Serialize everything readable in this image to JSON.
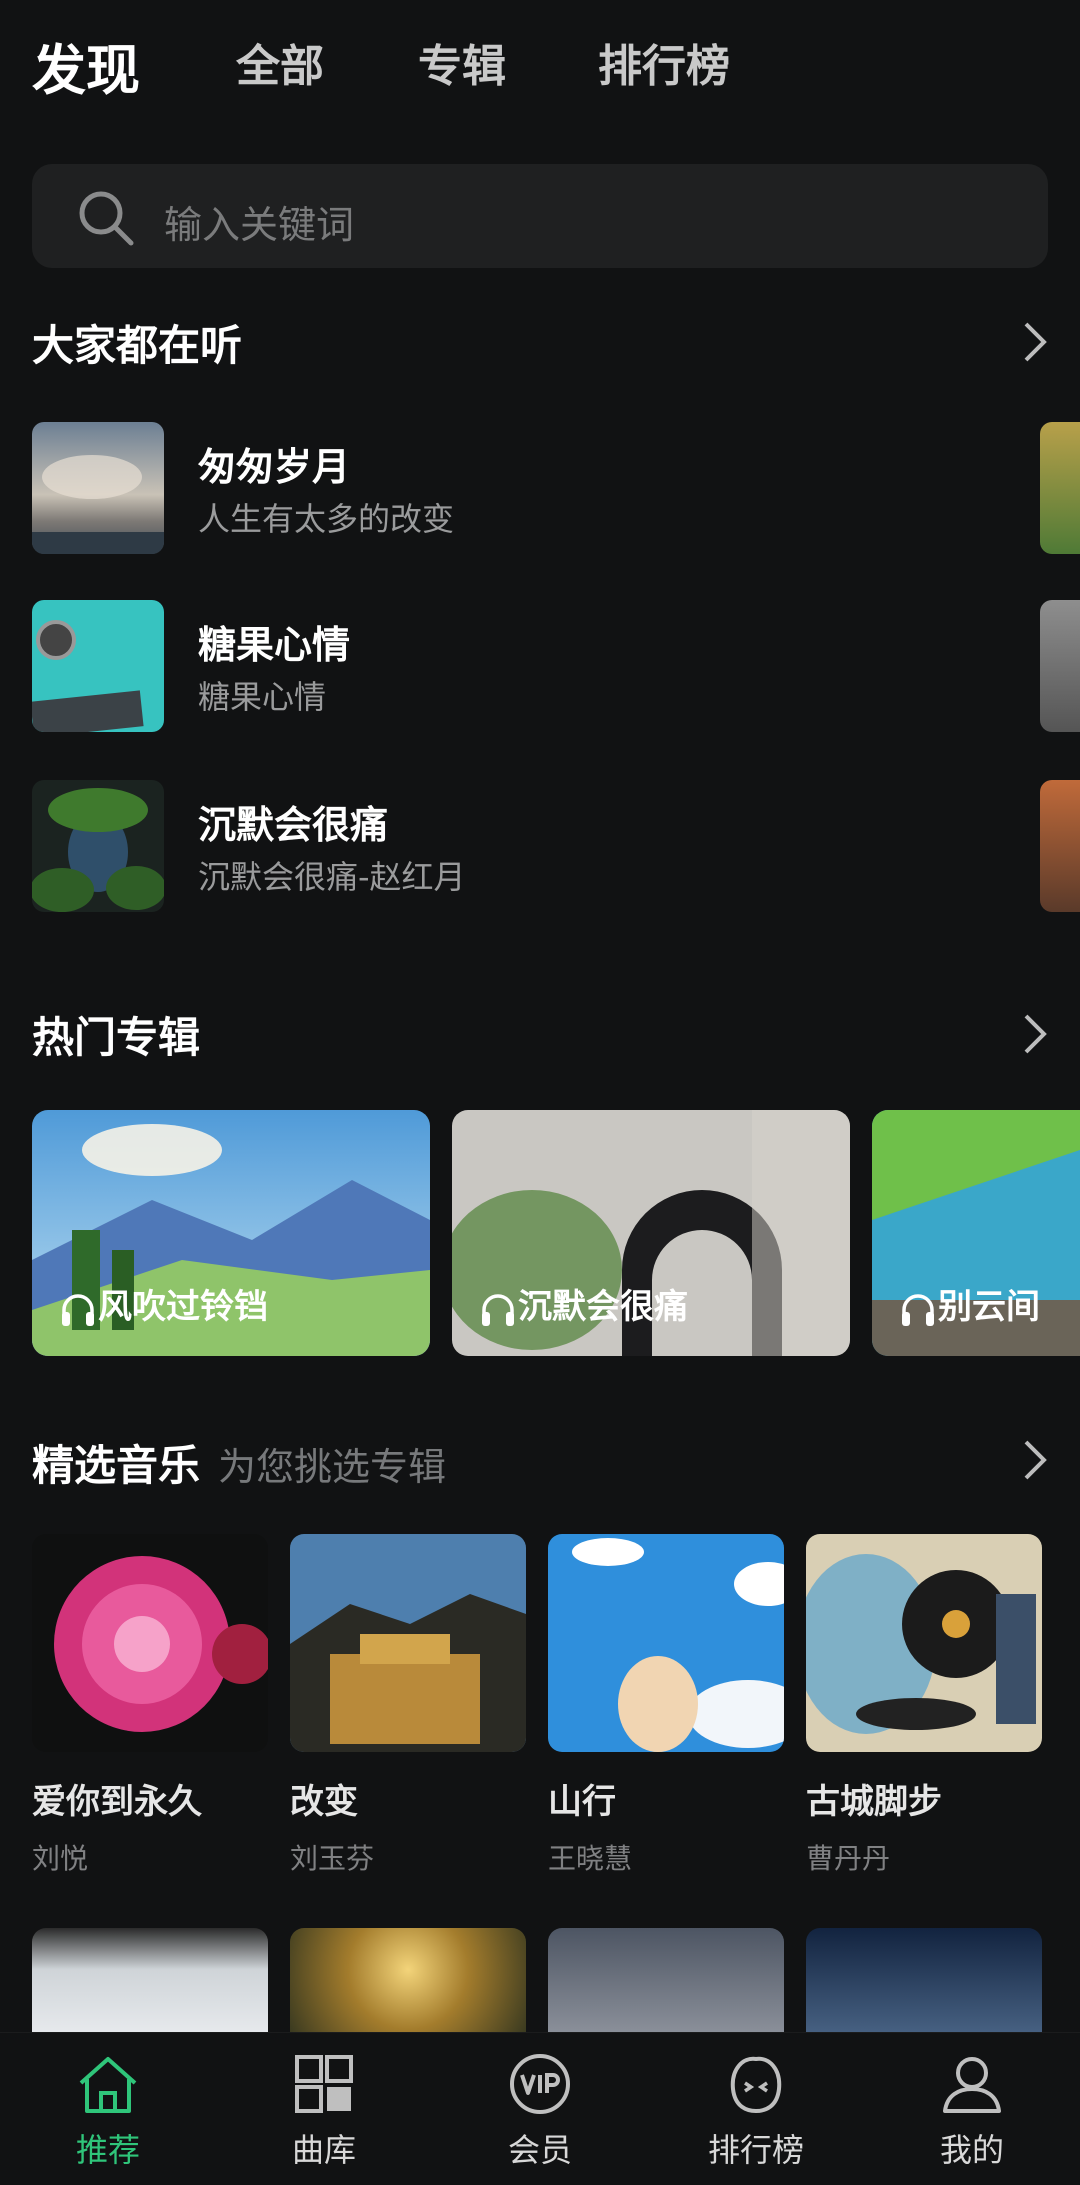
{
  "top_tabs": [
    "发现",
    "全部",
    "专辑",
    "排行榜"
  ],
  "search": {
    "placeholder": "输入关键词"
  },
  "popular": {
    "title": "大家都在听",
    "songs": [
      {
        "title": "匆匆岁月",
        "subtitle": "人生有太多的改变"
      },
      {
        "title": "糖果心情",
        "subtitle": "糖果心情"
      },
      {
        "title": "沉默会很痛",
        "subtitle": "沉默会很痛-赵红月"
      }
    ]
  },
  "hot_albums": {
    "title": "热门专辑",
    "albums": [
      "风吹过铃铛",
      "沉默会很痛",
      "别云间"
    ]
  },
  "featured": {
    "title": "精选音乐",
    "subtitle": "为您挑选专辑",
    "items": [
      {
        "name": "爱你到永久",
        "artist": "刘悦"
      },
      {
        "name": "改变",
        "artist": "刘玉芬"
      },
      {
        "name": "山行",
        "artist": "王晓慧"
      },
      {
        "name": "古城脚步",
        "artist": "曹丹丹"
      }
    ]
  },
  "bottom_nav": [
    "推荐",
    "曲库",
    "会员",
    "排行榜",
    "我的"
  ],
  "colors": {
    "accent": "#2fc57a",
    "background": "#111213"
  }
}
